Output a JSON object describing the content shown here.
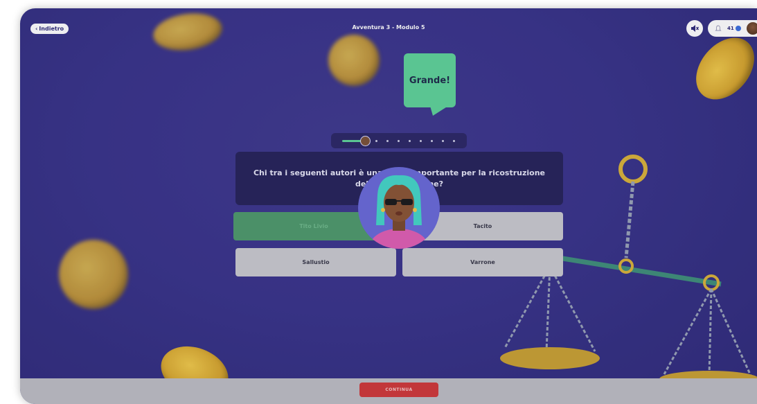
{
  "header": {
    "back_label": "Indietro",
    "title": "Avventura 3 - Modulo 5",
    "coins": "41",
    "icons": {
      "back": "chevron-left-icon",
      "mute": "speaker-muted-icon",
      "bell": "bell-icon",
      "coin": "coin-icon"
    }
  },
  "feedback": {
    "text": "Grande!"
  },
  "progress": {
    "current_step": 1,
    "total_steps": 9,
    "fill_fraction": 0.25
  },
  "question": {
    "line1": "Chi tra i seguenti autori è una fonte importante per la ricostruzione",
    "line2": "della vita di Catone?"
  },
  "answers": [
    {
      "label": "Tito Livio",
      "state": "correct"
    },
    {
      "label": "Tacito",
      "state": "default"
    },
    {
      "label": "Sallustio",
      "state": "default"
    },
    {
      "label": "Varrone",
      "state": "default"
    }
  ],
  "footer": {
    "continue_label": "CONTINUA"
  },
  "colors": {
    "background": "#39338a",
    "accent_green": "#5fd39a",
    "continue_red": "#d0393a"
  }
}
